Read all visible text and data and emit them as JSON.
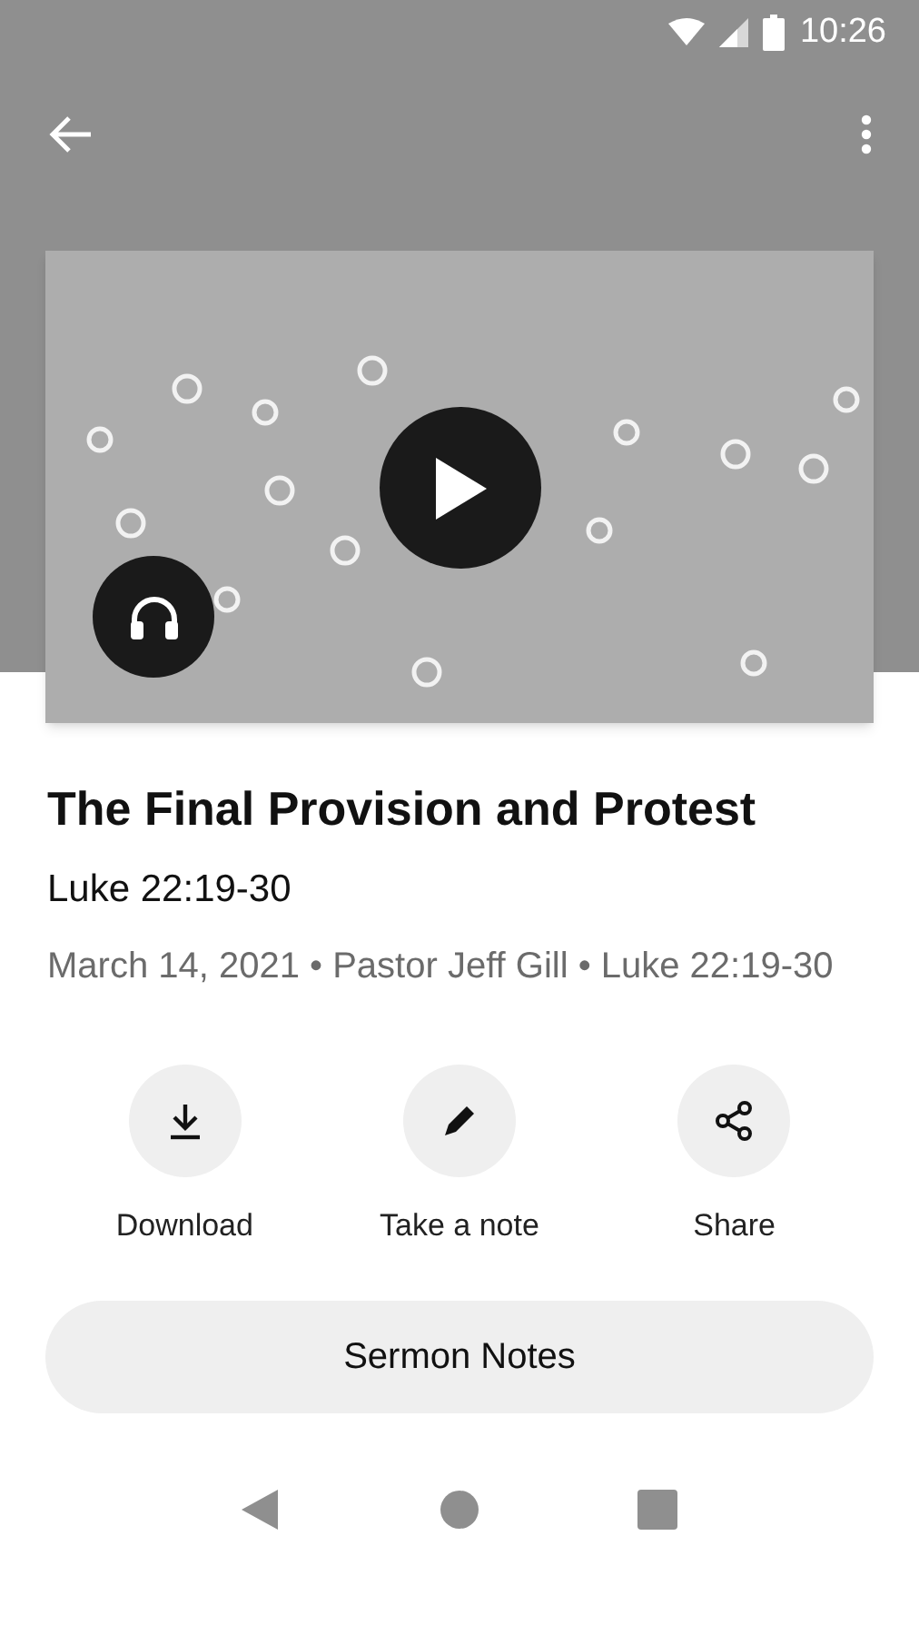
{
  "status_bar": {
    "time": "10:26"
  },
  "sermon": {
    "title": "The Final Provision and Protest",
    "scripture": "Luke 22:19-30",
    "meta": "March 14, 2021 • Pastor Jeff Gill • Luke 22:19-30"
  },
  "actions": [
    {
      "kind": "download",
      "label": "Download"
    },
    {
      "kind": "note",
      "label": "Take a note"
    },
    {
      "kind": "share",
      "label": "Share"
    }
  ],
  "notes_button": {
    "label": "Sermon Notes"
  }
}
